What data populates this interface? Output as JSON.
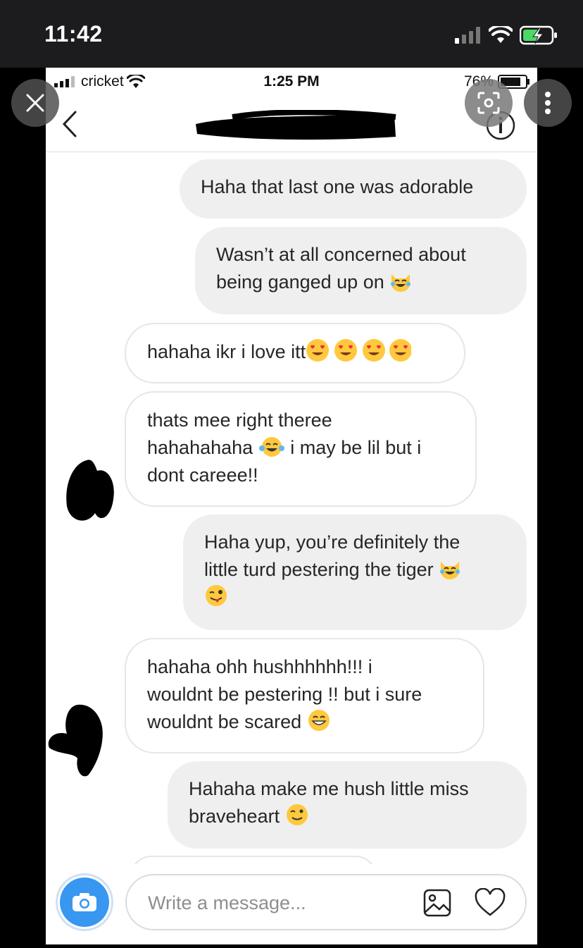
{
  "outer_status": {
    "time": "11:42"
  },
  "inner_status": {
    "carrier": "cricket",
    "time": "1:25 PM",
    "battery": "76%"
  },
  "messages": [
    {
      "side": "me",
      "text": "Haha that last one was adorable"
    },
    {
      "side": "me",
      "lines": [
        "Wasn’t at all concerned about",
        "being ganged up on"
      ],
      "emoji": "cat-tears-of-joy"
    },
    {
      "side": "them",
      "text": "hahaha ikr i love itt",
      "emoji": "heart-eyes x4"
    },
    {
      "side": "them",
      "lines": [
        "thats mee right theree",
        "hahahahaha",
        "i may be lil but i",
        "dont careee!!"
      ],
      "emoji": "tears-of-joy"
    },
    {
      "side": "me",
      "lines": [
        "Haha yup, you’re definitely the",
        "little turd pestering the tiger"
      ],
      "emoji": "cat-tears-of-joy, winking-tongue"
    },
    {
      "side": "them",
      "lines": [
        "hahaha ohh hushhhhhh!!! i",
        "wouldnt be pestering !! but i sure",
        "wouldnt be scared"
      ],
      "emoji": "grinning"
    },
    {
      "side": "me",
      "lines": [
        "Hahaha make me hush little miss",
        "braveheart"
      ],
      "emoji": "wink"
    }
  ],
  "composer": {
    "placeholder": "Write a message..."
  },
  "colors": {
    "accent": "#3897f0",
    "bubble_me": "#efefef",
    "bubble_them_border": "#e6e6e6"
  }
}
